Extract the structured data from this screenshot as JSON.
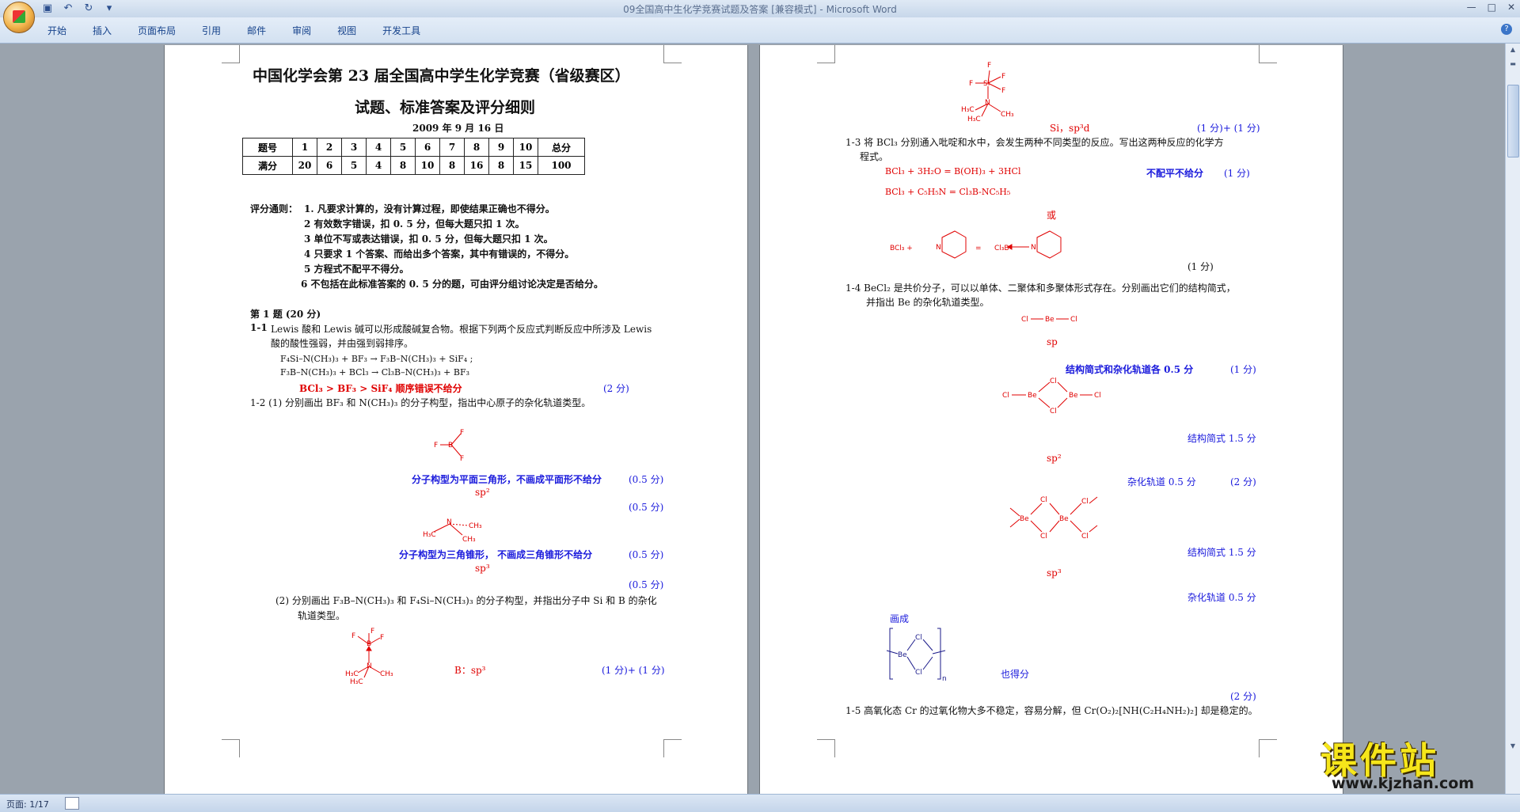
{
  "window": {
    "title": "09全国高中生化学竞赛试题及答案 [兼容模式] - Microsoft Word",
    "controls": [
      "—",
      "□",
      "✕"
    ]
  },
  "qat": {
    "save_icon": "save-icon",
    "undo_icon": "undo-icon",
    "redo_icon": "redo-icon",
    "more": "▾"
  },
  "ribbon": {
    "tabs": [
      "开始",
      "插入",
      "页面布局",
      "引用",
      "邮件",
      "审阅",
      "视图",
      "开发工具"
    ],
    "help": "?"
  },
  "status": {
    "page": "页面: 1/17"
  },
  "watermark": {
    "title": "课件站",
    "url": "www.kjzhan.com"
  },
  "left": {
    "title1": "中国化学会第 23 届全国高中学生化学竞赛（省级赛区）",
    "title2": "试题、标准答案及评分细则",
    "date": "2009 年 9 月 16 日",
    "score_table": {
      "row1_label": "题号",
      "row1": [
        "1",
        "2",
        "3",
        "4",
        "5",
        "6",
        "7",
        "8",
        "9",
        "10"
      ],
      "row1_total": "总分",
      "row2_label": "满分",
      "row2": [
        "20",
        "6",
        "5",
        "4",
        "8",
        "10",
        "8",
        "16",
        "8",
        "15"
      ],
      "row2_total": "100"
    },
    "rules_head": "评分通则：",
    "rules": [
      "1. 凡要求计算的，没有计算过程，即使结果正确也不得分。",
      "2 有效数字错误，扣 0. 5 分，但每大题只扣 1 次。",
      "3 单位不写或表达错误，扣 0. 5 分，但每大题只扣 1 次。",
      "4 只要求 1 个答案、而给出多个答案，其中有错误的，不得分。",
      "5 方程式不配平不得分。",
      "6 不包括在此标准答案的 0. 5 分的题，可由评分组讨论决定是否给分。"
    ],
    "q1_head": "第 1 题 (20 分)",
    "q1_1_num": "1-1",
    "q1_1_text1": "Lewis 酸和 Lewis 碱可以形成酸碱复合物。根据下列两个反应式判断反应中所涉及 Lewis",
    "q1_1_text2": "酸的酸性强弱，并由强到弱排序。",
    "eq1": "F₄Si–N(CH₃)₃ + BF₃   →   F₃B–N(CH₃)₃ + SiF₄ ;",
    "eq2": "F₃B–N(CH₃)₃ + BCl₃   →   Cl₃B–N(CH₃)₃ + BF₃",
    "ans1": "BCl₃   >   BF₃   >   SiF₄     顺序错误不给分",
    "ans1_score": "(2 分)",
    "q1_2": "1-2  (1)  分别画出 BF₃ 和 N(CH₃)₃ 的分子构型，指出中心原子的杂化轨道类型。",
    "bf3_note": "分子构型为平面三角形，不画成平面形不给分",
    "bf3_score": "(0.5 分)",
    "sp2": "sp²",
    "sp2_score": "(0.5 分)",
    "nme3_note": "分子构型为三角锥形，  不画成三角锥形不给分",
    "nme3_score": "(0.5 分)",
    "sp3": "sp³",
    "sp3_score": "(0.5 分)",
    "q1_2_2a": "(2)   分别画出 F₃B–N(CH₃)₃ 和 F₄Si–N(CH₃)₃ 的分子构型，并指出分子中 Si 和 B 的杂化",
    "q1_2_2b": "轨道类型。",
    "b_sp3": "B：sp³",
    "b_score": "(1 分)+ (1 分)"
  },
  "right": {
    "si_sp3d": "Si，sp³d",
    "si_score": "(1 分)+ (1 分)",
    "q1_3_a": "1-3   将  BCl₃ 分别通入吡啶和水中，会发生两种不同类型的反应。写出这两种反应的化学方",
    "q1_3_b": "程式。",
    "r1": "BCl₃ + 3H₂O = B(OH)₃ + 3HCl",
    "r1_note": "不配平不给分",
    "r1_score": "(1 分)",
    "r2": "BCl₃ + C₅H₅N = Cl₃B-NC₅H₅",
    "or": "或",
    "py_score": "(1 分)",
    "q1_4_a": "1-4  BeCl₂ 是共价分子，可以以单体、二聚体和多聚体形式存在。分别画出它们的结构简式，",
    "q1_4_b": "并指出 Be 的杂化轨道类型。",
    "sp": "sp",
    "mono_note": "结构简式和杂化轨道各 0.5 分",
    "mono_score": "(1 分)",
    "dimer_note": "结构简式 1.5 分",
    "sp2": "sp²",
    "dimer_hyb": "杂化轨道 0.5 分",
    "dimer_score": "(2 分)",
    "poly_note": "结构简式 1.5 分",
    "sp3": "sp³",
    "poly_hyb": "杂化轨道 0.5 分",
    "draw_as": "画成",
    "also": "也得分",
    "poly_score": "(2 分)",
    "q1_5": "1-5   高氧化态 Cr 的过氧化物大多不稳定，容易分解，但 Cr(O₂)₂[NH(C₂H₄NH₂)₂]  却是稳定的。"
  }
}
